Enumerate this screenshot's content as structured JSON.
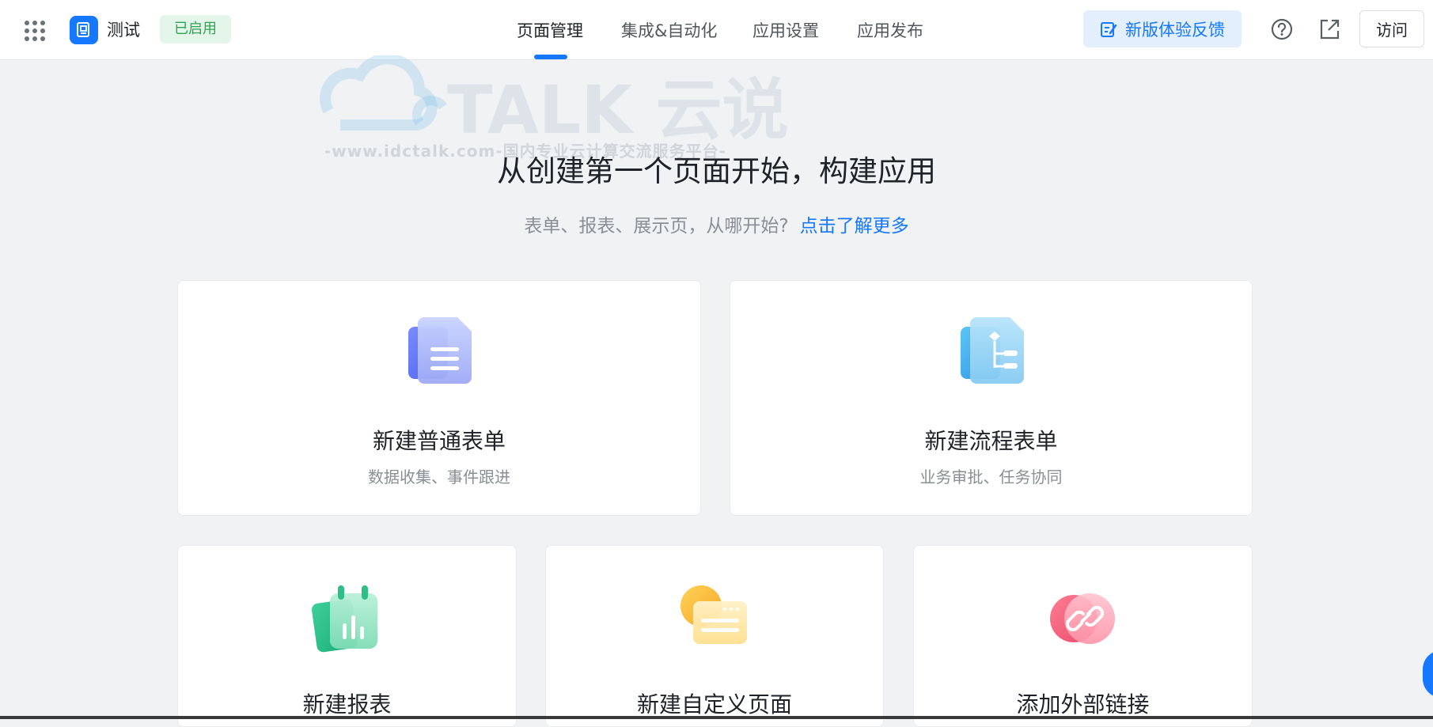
{
  "header": {
    "app_name": "测试",
    "status": "已启用",
    "tabs": [
      {
        "label": "页面管理",
        "active": true
      },
      {
        "label": "集成&自动化",
        "active": false
      },
      {
        "label": "应用设置",
        "active": false
      },
      {
        "label": "应用发布",
        "active": false
      }
    ],
    "feedback_label": "新版体验反馈",
    "visit_label": "访问",
    "icons": [
      "apps-grid-icon",
      "app-logo-icon",
      "feedback-edit-icon",
      "help-icon",
      "external-link-icon"
    ]
  },
  "hero": {
    "title": "从创建第一个页面开始，构建应用",
    "subtitle": "表单、报表、展示页，从哪开始?",
    "learn_more": "点击了解更多"
  },
  "cards": [
    {
      "title": "新建普通表单",
      "desc": "数据收集、事件跟进",
      "icon": "form-document-icon"
    },
    {
      "title": "新建流程表单",
      "desc": "业务审批、任务协同",
      "icon": "workflow-form-icon"
    },
    {
      "title": "新建报表",
      "desc": "",
      "icon": "report-chart-icon"
    },
    {
      "title": "新建自定义页面",
      "desc": "",
      "icon": "custom-page-icon"
    },
    {
      "title": "添加外部链接",
      "desc": "",
      "icon": "external-link-chain-icon"
    }
  ],
  "watermark": {
    "brand": "TALK 云说",
    "url": "-www.idctalk.com-国内专业云计算交流服务平台-"
  },
  "colors": {
    "accent": "#1677ff",
    "status_green": "#2ea44f",
    "background": "#f1f2f4"
  }
}
